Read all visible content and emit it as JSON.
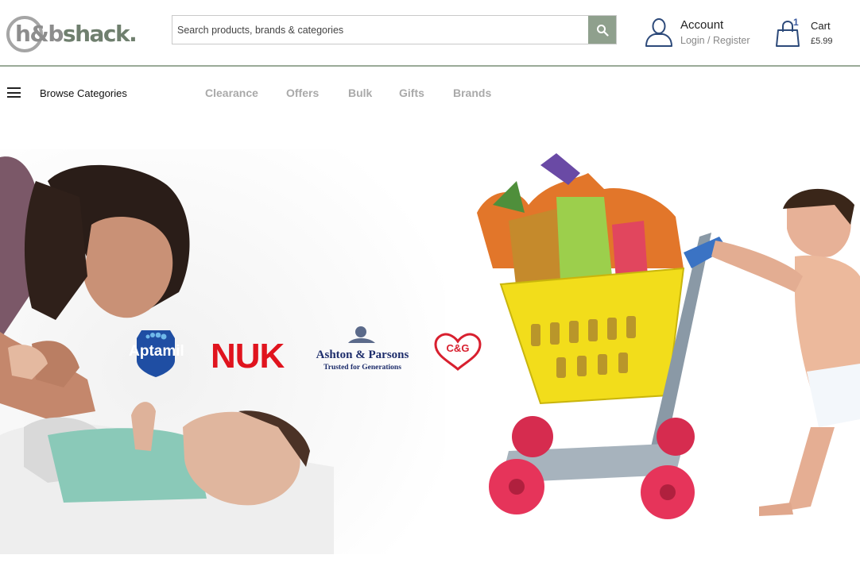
{
  "header": {
    "logo": {
      "part1": "h&b",
      "part2": "shack."
    },
    "search": {
      "placeholder": "Search products, brands & categories",
      "icon": "search-icon"
    },
    "account": {
      "title": "Account",
      "subtitle": "Login / Register",
      "icon": "user-icon"
    },
    "cart": {
      "title": "Cart",
      "total": "£5.99",
      "count": "1",
      "icon": "shopping-bag-icon"
    }
  },
  "nav": {
    "menu_icon": "hamburger-icon",
    "browse_label": "Browse Categories",
    "links": [
      "Clearance",
      "Offers",
      "Bulk",
      "Gifts",
      "Brands"
    ]
  },
  "hero": {
    "brands": {
      "aptamil": "Aptamil",
      "nuk": "NUK",
      "ashton_name": "Ashton & Parsons",
      "ashton_tagline": "Trusted for Generations",
      "cg_logo": "C&G"
    }
  },
  "colors": {
    "accent": "#8fa08d",
    "divider": "#9aaa98",
    "nav_link": "#a9a9a9",
    "account_icon": "#2d4a7a",
    "cart_count": "#3b5aa0"
  }
}
